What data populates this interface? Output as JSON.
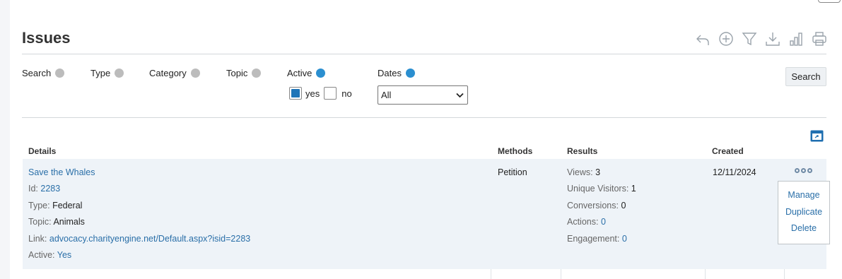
{
  "page": {
    "title": "Issues"
  },
  "toolbar": {
    "icons": [
      "back-icon",
      "add-icon",
      "filter-icon",
      "download-icon",
      "chart-icon",
      "print-icon"
    ]
  },
  "filters": {
    "search_label": "Search",
    "type_label": "Type",
    "category_label": "Category",
    "topic_label": "Topic",
    "active_label": "Active",
    "dates_label": "Dates",
    "active_yes_label": "yes",
    "active_no_label": "no",
    "active_yes_checked": true,
    "active_no_checked": false,
    "dates_value": "All",
    "search_button": "Search",
    "colors": {
      "inactive_dot": "#bcbcbc",
      "active_dot": "#2b8fd0"
    }
  },
  "table": {
    "headers": {
      "details": "Details",
      "methods": "Methods",
      "results": "Results",
      "created": "Created"
    },
    "row": {
      "name": "Save the Whales",
      "id_label": "Id:",
      "id_value": "2283",
      "type_label": "Type:",
      "type_value": "Federal",
      "topic_label": "Topic:",
      "topic_value": "Animals",
      "link_label": "Link:",
      "link_value": "advocacy.charityengine.net/Default.aspx?isid=2283",
      "active_label": "Active:",
      "active_value": "Yes",
      "method": "Petition",
      "views_label": "Views:",
      "views_value": "3",
      "unique_label": "Unique Visitors:",
      "unique_value": "1",
      "conversions_label": "Conversions:",
      "conversions_value": "0",
      "actions_label": "Actions:",
      "actions_value": "0",
      "engagement_label": "Engagement:",
      "engagement_value": "0",
      "created": "12/11/2024"
    },
    "row_menu": {
      "manage": "Manage",
      "duplicate": "Duplicate",
      "delete": "Delete"
    }
  }
}
